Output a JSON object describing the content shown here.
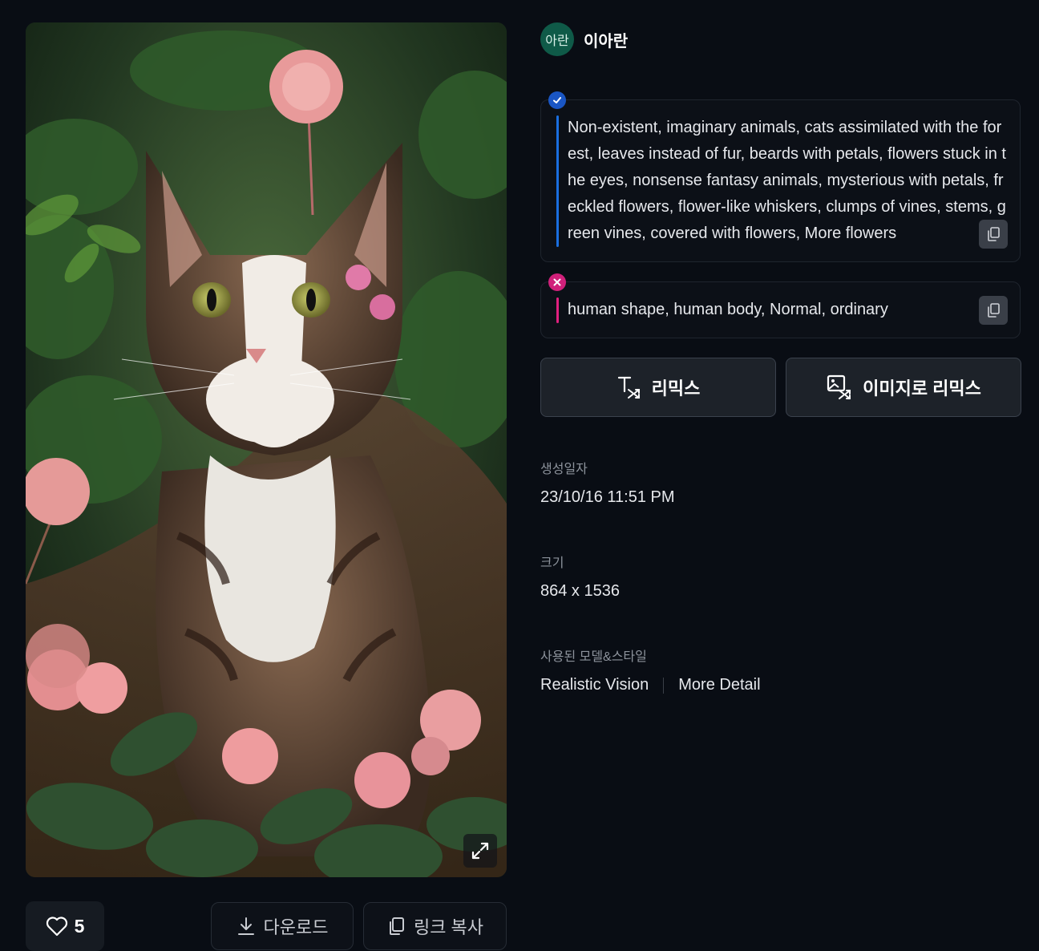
{
  "author": {
    "avatar_text": "아란",
    "name": "이아란",
    "avatar_color": "#0f5a48"
  },
  "image": {
    "expand_icon": "expand-icon"
  },
  "actions": {
    "like_count": "5",
    "download_label": "다운로드",
    "copy_link_label": "링크 복사"
  },
  "prompt": {
    "positive": "Non-existent, imaginary animals, cats assimilated with the forest, leaves instead of fur, beards with petals, flowers stuck in the eyes, nonsense fantasy animals, mysterious with petals, freckled flowers, flower-like whiskers, clumps of vines, stems, green vines, covered with flowers, More flowers",
    "negative": "human shape, human body, Normal, ordinary",
    "positive_color": "#1a56c4",
    "negative_color": "#d0207a"
  },
  "remix": {
    "text_label": "리믹스",
    "image_label": "이미지로 리믹스"
  },
  "meta": {
    "created_label": "생성일자",
    "created_value": "23/10/16 11:51 PM",
    "size_label": "크기",
    "size_value": "864 x 1536",
    "model_label": "사용된 모델&스타일",
    "models": [
      "Realistic Vision",
      "More Detail"
    ]
  }
}
